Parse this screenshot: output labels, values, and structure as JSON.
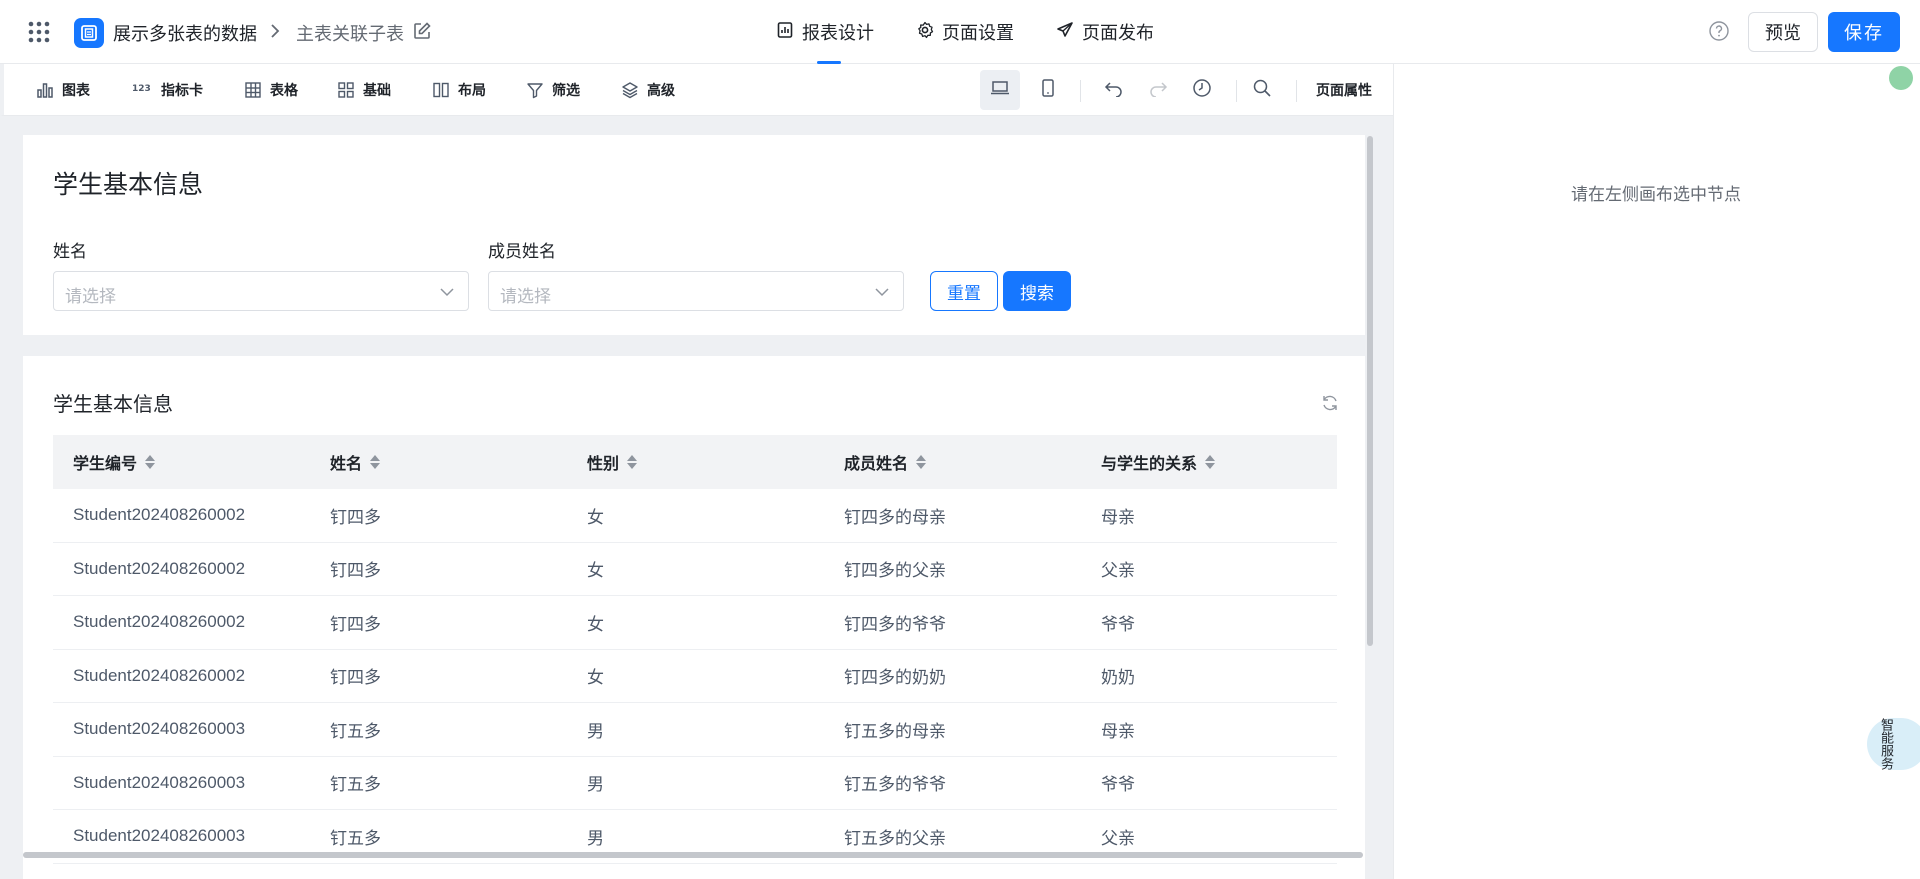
{
  "header": {
    "breadcrumb_app": "展示多张表的数据",
    "breadcrumb_page": "主表关联子表",
    "tabs": [
      {
        "label": "报表设计",
        "icon": "report-design-icon",
        "active": true
      },
      {
        "label": "页面设置",
        "icon": "gear-icon",
        "active": false
      },
      {
        "label": "页面发布",
        "icon": "send-icon",
        "active": false
      }
    ],
    "preview_label": "预览",
    "save_label": "保存"
  },
  "toolbar": {
    "items": [
      {
        "label": "图表",
        "icon": "bar-chart-icon"
      },
      {
        "label": "指标卡",
        "icon": "number-card-icon"
      },
      {
        "label": "表格",
        "icon": "table-grid-icon"
      },
      {
        "label": "基础",
        "icon": "basic-blocks-icon"
      },
      {
        "label": "布局",
        "icon": "layout-columns-icon"
      },
      {
        "label": "筛选",
        "icon": "filter-funnel-icon"
      },
      {
        "label": "高级",
        "icon": "layers-icon"
      }
    ],
    "page_props_label": "页面属性"
  },
  "filter_card": {
    "title": "学生基本信息",
    "fields": [
      {
        "label": "姓名",
        "placeholder": "请选择"
      },
      {
        "label": "成员姓名",
        "placeholder": "请选择"
      }
    ],
    "reset_label": "重置",
    "search_label": "搜索"
  },
  "table_card": {
    "title": "学生基本信息",
    "columns": [
      "学生编号",
      "姓名",
      "性别",
      "成员姓名",
      "与学生的关系"
    ],
    "rows": [
      [
        "Student202408260002",
        "钉四多",
        "女",
        "钉四多的母亲",
        "母亲"
      ],
      [
        "Student202408260002",
        "钉四多",
        "女",
        "钉四多的父亲",
        "父亲"
      ],
      [
        "Student202408260002",
        "钉四多",
        "女",
        "钉四多的爷爷",
        "爷爷"
      ],
      [
        "Student202408260002",
        "钉四多",
        "女",
        "钉四多的奶奶",
        "奶奶"
      ],
      [
        "Student202408260003",
        "钉五多",
        "男",
        "钉五多的母亲",
        "母亲"
      ],
      [
        "Student202408260003",
        "钉五多",
        "男",
        "钉五多的爷爷",
        "爷爷"
      ],
      [
        "Student202408260003",
        "钉五多",
        "男",
        "钉五多的父亲",
        "父亲"
      ]
    ]
  },
  "right_panel": {
    "message": "请在左侧画布选中节点"
  },
  "assistant": {
    "label": "智能服务"
  },
  "colors": {
    "accent": "#1677ff",
    "canvas_bg": "#eef0f3",
    "table_header_bg": "#f2f3f5"
  }
}
